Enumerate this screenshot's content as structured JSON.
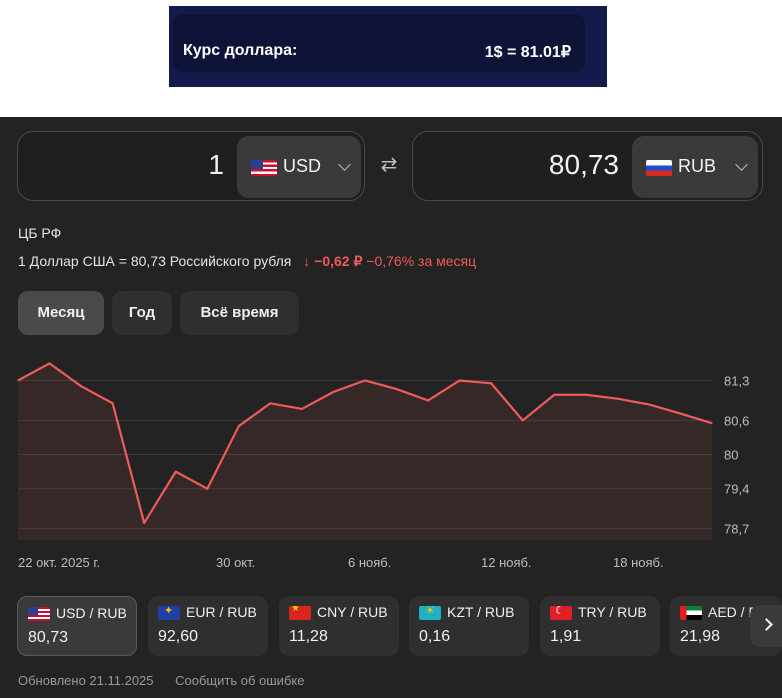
{
  "banner": {
    "label": "Курс доллара:",
    "rate": "1$ = 81.01₽"
  },
  "converter": {
    "from": {
      "amount": "1",
      "currency": "USD",
      "flag": "us-flag-icon"
    },
    "to": {
      "amount": "80,73",
      "currency": "RUB",
      "flag": "ru-flag-icon"
    }
  },
  "info": {
    "source": "ЦБ РФ",
    "rate_text": "1 Доллар США = 80,73 Российского рубля",
    "change_arrow": "↓",
    "change_abs": "−0,62 ₽",
    "change_pct": "−0,76%",
    "change_period": "за месяц",
    "change_color": "#ef5a5a"
  },
  "tabs": [
    {
      "label": "Месяц",
      "active": true
    },
    {
      "label": "Год",
      "active": false
    },
    {
      "label": "Всё время",
      "active": false
    }
  ],
  "chart_data": {
    "type": "area",
    "x": [
      "21.10",
      "22.10",
      "23.10",
      "24.10",
      "25.10",
      "28.10",
      "29.10",
      "30.10",
      "31.10",
      "01.11",
      "05.11",
      "06.11",
      "07.11",
      "08.11",
      "11.11",
      "12.11",
      "13.11",
      "14.11",
      "15.11",
      "18.11",
      "19.11",
      "20.11",
      "21.11"
    ],
    "x_ticks": [
      "22 окт. 2025 г.",
      "30 окт.",
      "6 нояб.",
      "12 нояб.",
      "18 нояб."
    ],
    "y_ticks": [
      "81,3",
      "80,6",
      "80",
      "79,4",
      "78,7"
    ],
    "series": [
      {
        "values": [
          81.3,
          81.6,
          81.2,
          80.9,
          78.8,
          79.7,
          79.4,
          80.5,
          80.9,
          80.8,
          81.1,
          81.3,
          81.15,
          80.95,
          81.3,
          81.25,
          80.6,
          81.05,
          81.05,
          80.98,
          80.88,
          80.72,
          80.55
        ]
      }
    ],
    "ylim": [
      78.5,
      81.8
    ],
    "line_color": "#ef5a5a",
    "grid": true
  },
  "pairs": [
    {
      "name": "USD / RUB",
      "value": "80,73",
      "flag": "us-flag-icon",
      "active": true
    },
    {
      "name": "EUR / RUB",
      "value": "92,60",
      "flag": "eu-flag-icon",
      "active": false
    },
    {
      "name": "CNY / RUB",
      "value": "11,28",
      "flag": "cn-flag-icon",
      "active": false
    },
    {
      "name": "KZT / RUB",
      "value": "0,16",
      "flag": "kz-flag-icon",
      "active": false
    },
    {
      "name": "TRY / RUB",
      "value": "1,91",
      "flag": "tr-flag-icon",
      "active": false
    },
    {
      "name": "AED / F",
      "value": "21,98",
      "flag": "ae-flag-icon",
      "active": false
    }
  ],
  "footer": {
    "updated": "Обновлено 21.11.2025",
    "report": "Сообщить об ошибке"
  }
}
